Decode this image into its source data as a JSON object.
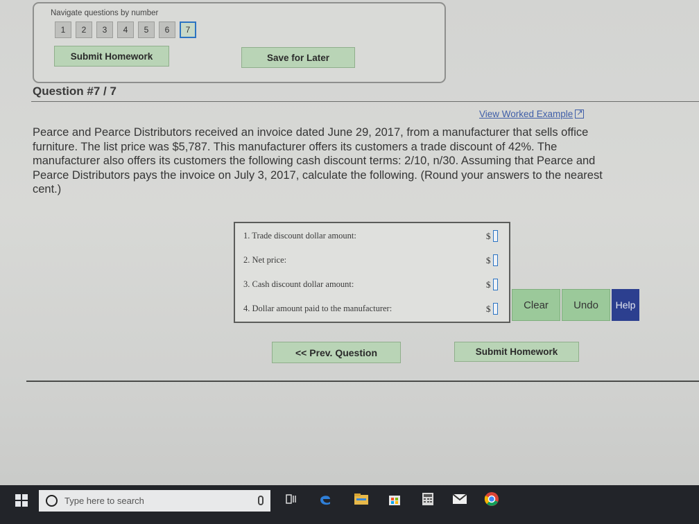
{
  "nav": {
    "label": "Navigate questions by number",
    "numbers": [
      "1",
      "2",
      "3",
      "4",
      "5",
      "6",
      "7"
    ],
    "active": "7",
    "submit_label": "Submit Homework",
    "save_label": "Save for Later"
  },
  "question": {
    "title": "Question #7 / 7",
    "worked_example": "View Worked Example",
    "text": "Pearce and Pearce Distributors received an invoice dated June 29, 2017, from a manufacturer that sells office furniture. The list price was $5,787. This manufacturer offers its customers a trade discount of 42%. The manufacturer also offers its customers the following cash discount terms: 2/10, n/30. Assuming that Pearce and Pearce Distributors pays the invoice on July 3, 2017, calculate the following. (Round your answers to the nearest cent.)"
  },
  "answers": [
    {
      "label": "1. Trade discount dollar amount:",
      "currency": "$",
      "value": ""
    },
    {
      "label": "2. Net price:",
      "currency": "$",
      "value": ""
    },
    {
      "label": "3. Cash discount dollar amount:",
      "currency": "$",
      "value": ""
    },
    {
      "label": "4. Dollar amount paid to the manufacturer:",
      "currency": "$",
      "value": ""
    }
  ],
  "actions": {
    "clear": "Clear",
    "undo": "Undo",
    "help": "Help"
  },
  "bottom_nav": {
    "prev": "<< Prev. Question",
    "submit": "Submit Homework"
  },
  "taskbar": {
    "search_placeholder": "Type here to search",
    "icons": [
      "windows-icon",
      "microphone-icon",
      "task-view-icon",
      "edge-icon",
      "file-explorer-icon",
      "store-icon",
      "calculator-icon",
      "mail-icon",
      "chrome-icon"
    ]
  },
  "colors": {
    "button_green": "#b9d4b6",
    "action_green": "#9bc99a",
    "help_blue": "#2c3f8f",
    "input_border": "#2c74c2",
    "link": "#3f5ea8",
    "taskbar": "#222429"
  }
}
